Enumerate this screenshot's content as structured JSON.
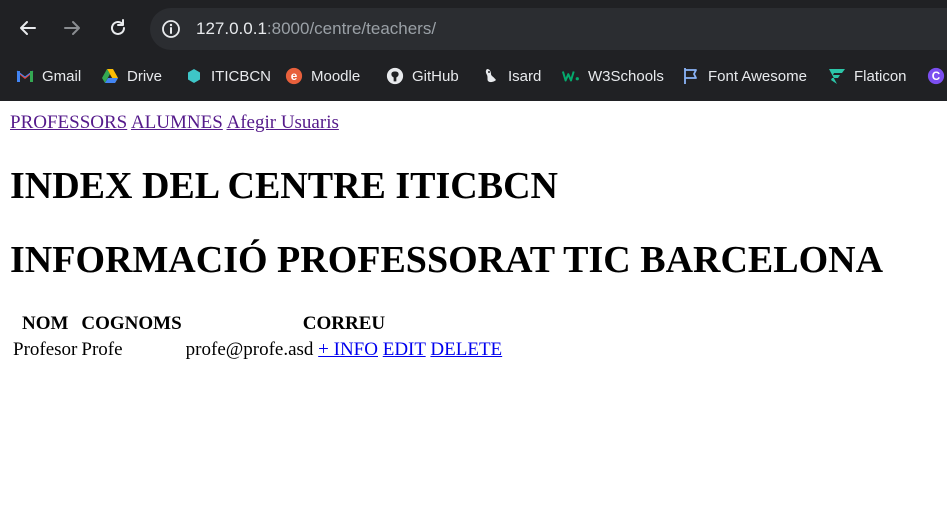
{
  "browser": {
    "url_host": "127.0.0.1",
    "url_rest": ":8000/centre/teachers/",
    "bookmarks": [
      {
        "label": "Gmail",
        "icon": "gmail-icon"
      },
      {
        "label": "Drive",
        "icon": "drive-icon"
      },
      {
        "label": "ITICBCN",
        "icon": "iticbcn-icon"
      },
      {
        "label": "Moodle",
        "icon": "moodle-icon"
      },
      {
        "label": "GitHub",
        "icon": "github-icon"
      },
      {
        "label": "Isard",
        "icon": "isard-icon"
      },
      {
        "label": "W3Schools",
        "icon": "w3schools-icon"
      },
      {
        "label": "Font Awesome",
        "icon": "font-awesome-icon"
      },
      {
        "label": "Flaticon",
        "icon": "flaticon-icon"
      }
    ]
  },
  "nav": {
    "professors": "PROFESSORS",
    "alumnes": "ALUMNES",
    "afegir": "Afegir Usuaris"
  },
  "headings": {
    "index": "INDEX DEL CENTRE ITICBCN",
    "info": "INFORMACIÓ PROFESSORAT TIC BARCELONA"
  },
  "table": {
    "headers": [
      "NOM",
      "COGNOMS",
      "CORREU"
    ],
    "rows": [
      {
        "nom": "Profesor",
        "cognoms": "Profe",
        "correu": "profe@profe.asd",
        "info": "+ INFO",
        "edit": "EDIT",
        "delete": "DELETE"
      }
    ]
  },
  "colors": {
    "chrome_bg": "#202124",
    "omnibox_bg": "#2b2d31",
    "link_visited": "#551a8b",
    "link": "#0000ee"
  }
}
